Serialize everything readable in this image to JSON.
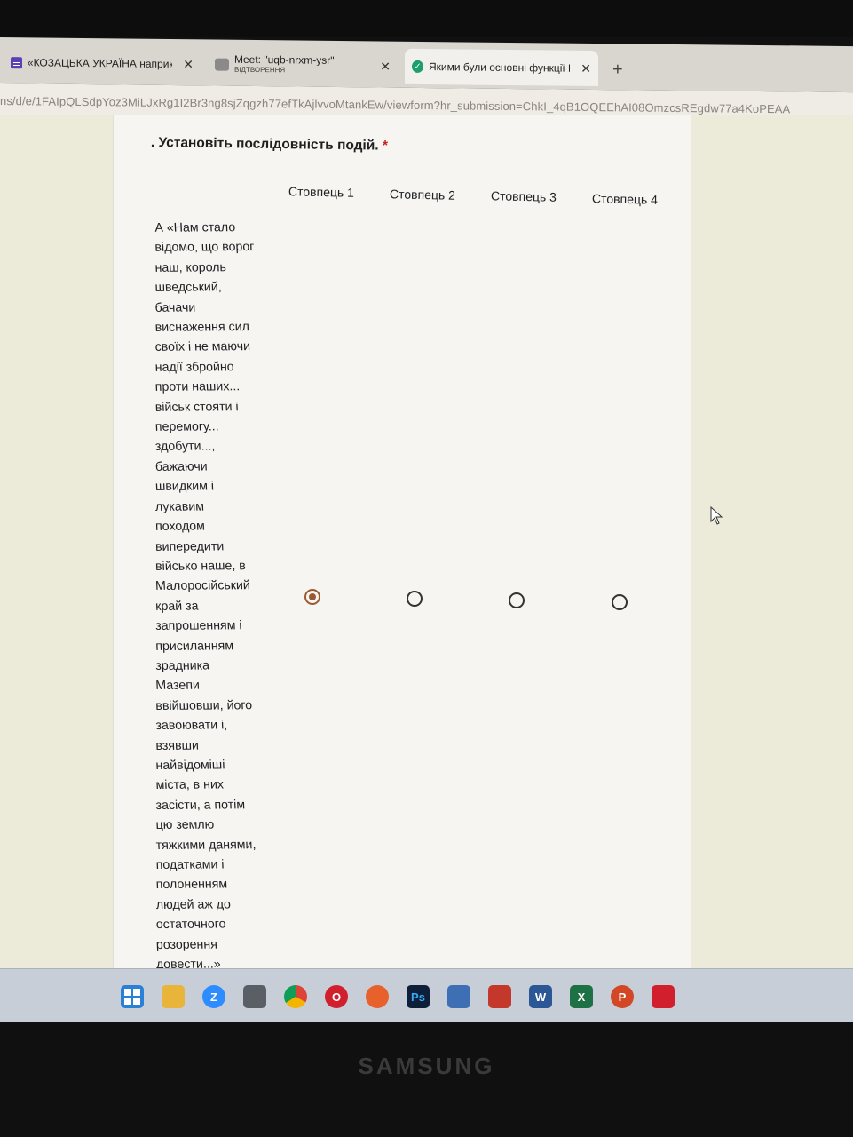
{
  "browser": {
    "tabs": [
      {
        "label": "«КОЗАЦЬКА УКРАЇНА наприк",
        "sub": ""
      },
      {
        "label": "Meet: \"uqb-nrxm-ysr\"",
        "sub": "ВІДТВОРЕННЯ"
      },
      {
        "label": "Якими були основні функції Г",
        "sub": ""
      }
    ],
    "new_tab": "+",
    "url": "ns/d/e/1FAIpQLSdpYoz3MiLJxRg1I2Br3ng8sjZqgzh77efTkAjlvvoMtankEw/viewform?hr_submission=ChkI_4qB1OQEEhAI08OmzcsREgdw77a4KoPEAA"
  },
  "form": {
    "question_prefix": ". ",
    "question": "Установіть послідовність подій.",
    "required_mark": "*",
    "columns": [
      "Стовпець 1",
      "Стовпець 2",
      "Стовпець 3",
      "Стовпець 4"
    ],
    "row_lines": [
      "А «Нам стало",
      "відомо, що ворог",
      "наш, король",
      "шведський,",
      "бачачи",
      "виснаження сил",
      "своїх і не маючи",
      "надії збройно",
      "проти наших...",
      "військ стояти і",
      "перемогу...",
      "здобути...,",
      "бажаючи",
      "швидким і",
      "лукавим",
      "походом",
      "випередити",
      "військо наше, в",
      "Малоросійський",
      "край за",
      "запрошенням і",
      "присиланням",
      "зрадника",
      "Мазепи",
      "ввійшовши, його",
      "завоювати і,",
      "взявши",
      "найвідоміші",
      "міста, в них",
      "засісти, а потім",
      "цю землю",
      "тяжкими данями,",
      "податками і",
      "полоненням",
      "людей аж до",
      "остаточного",
      "розорення",
      "довести...»"
    ],
    "selected_column": 1
  },
  "monitor": {
    "brand": "SAMSUNG"
  },
  "colors": {
    "radio_selected": "#9a5b34",
    "required": "#c5221f"
  }
}
